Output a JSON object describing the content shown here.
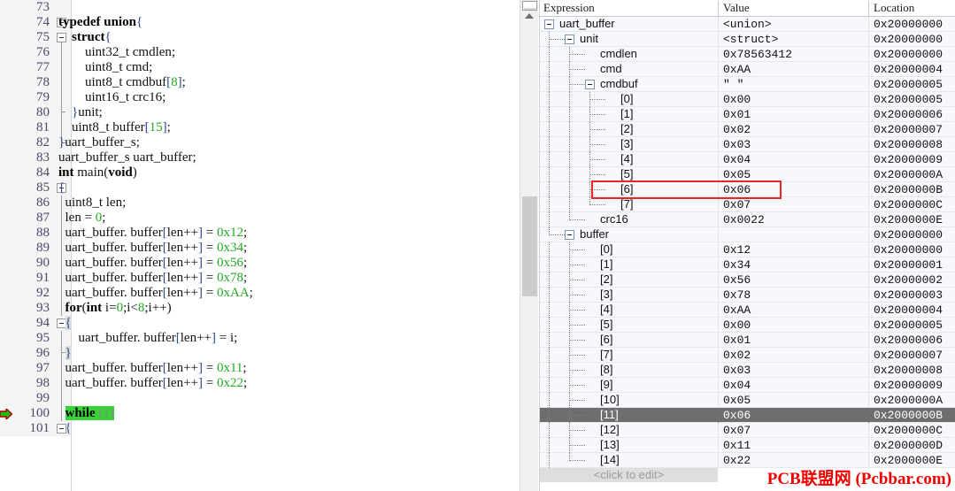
{
  "editor": {
    "first_line": 73,
    "exec_line": 100,
    "lines": [
      {
        "n": 73,
        "fold": "none",
        "tokens": []
      },
      {
        "n": 74,
        "fold": "open",
        "tokens": [
          {
            "t": "typedef union",
            "c": "kw"
          },
          {
            "t": "{",
            "c": "brk"
          }
        ]
      },
      {
        "n": 75,
        "fold": "open2",
        "tokens": [
          {
            "t": "    ",
            "c": "pln"
          },
          {
            "t": "struct",
            "c": "kw"
          },
          {
            "t": "{",
            "c": "brk"
          }
        ]
      },
      {
        "n": 76,
        "fold": "line",
        "tokens": [
          {
            "t": "        uint32_t cmdlen;",
            "c": "pln"
          }
        ]
      },
      {
        "n": 77,
        "fold": "line",
        "tokens": [
          {
            "t": "        uint8_t cmd;",
            "c": "pln"
          }
        ]
      },
      {
        "n": 78,
        "fold": "line",
        "tokens": [
          {
            "t": "        uint8_t cmdbuf",
            "c": "pln"
          },
          {
            "t": "[",
            "c": "brk"
          },
          {
            "t": "8",
            "c": "num"
          },
          {
            "t": "]",
            "c": "brk"
          },
          {
            "t": ";",
            "c": "pln"
          }
        ]
      },
      {
        "n": 79,
        "fold": "line",
        "tokens": [
          {
            "t": "        uint16_t crc16;",
            "c": "pln"
          }
        ]
      },
      {
        "n": 80,
        "fold": "endinner",
        "tokens": [
          {
            "t": "    ",
            "c": "pln"
          },
          {
            "t": "}",
            "c": "brk"
          },
          {
            "t": "unit;",
            "c": "pln"
          }
        ]
      },
      {
        "n": 81,
        "fold": "line",
        "tokens": [
          {
            "t": "    uint8_t buffer",
            "c": "pln"
          },
          {
            "t": "[",
            "c": "brk"
          },
          {
            "t": "15",
            "c": "num"
          },
          {
            "t": "]",
            "c": "brk"
          },
          {
            "t": ";",
            "c": "pln"
          }
        ]
      },
      {
        "n": 82,
        "fold": "endouter",
        "tokens": [
          {
            "t": "}",
            "c": "brk"
          },
          {
            "t": "uart_buffer_s;",
            "c": "pln"
          }
        ]
      },
      {
        "n": 83,
        "fold": "none",
        "tokens": [
          {
            "t": "uart_buffer_s uart_buffer;",
            "c": "pln"
          }
        ]
      },
      {
        "n": 84,
        "fold": "none",
        "tokens": [
          {
            "t": "int",
            "c": "kw"
          },
          {
            "t": " main(",
            "c": "pln"
          },
          {
            "t": "void",
            "c": "kw"
          },
          {
            "t": ")",
            "c": "pln"
          }
        ]
      },
      {
        "n": 85,
        "fold": "open",
        "tokens": [
          {
            "t": "{",
            "c": "brk"
          }
        ]
      },
      {
        "n": 86,
        "fold": "line",
        "tokens": [
          {
            "t": "  uint8_t len;",
            "c": "pln"
          }
        ]
      },
      {
        "n": 87,
        "fold": "line",
        "tokens": [
          {
            "t": "  len = ",
            "c": "pln"
          },
          {
            "t": "0",
            "c": "num"
          },
          {
            "t": ";",
            "c": "pln"
          }
        ]
      },
      {
        "n": 88,
        "fold": "line",
        "tokens": [
          {
            "t": "  uart_buffer. buffer",
            "c": "pln"
          },
          {
            "t": "[",
            "c": "brk"
          },
          {
            "t": "len++",
            "c": "pln"
          },
          {
            "t": "]",
            "c": "brk"
          },
          {
            "t": " = ",
            "c": "pln"
          },
          {
            "t": "0x12",
            "c": "num"
          },
          {
            "t": ";",
            "c": "pln"
          }
        ]
      },
      {
        "n": 89,
        "fold": "line",
        "tokens": [
          {
            "t": "  uart_buffer. buffer",
            "c": "pln"
          },
          {
            "t": "[",
            "c": "brk"
          },
          {
            "t": "len++",
            "c": "pln"
          },
          {
            "t": "]",
            "c": "brk"
          },
          {
            "t": " = ",
            "c": "pln"
          },
          {
            "t": "0x34",
            "c": "num"
          },
          {
            "t": ";",
            "c": "pln"
          }
        ]
      },
      {
        "n": 90,
        "fold": "line",
        "tokens": [
          {
            "t": "  uart_buffer. buffer",
            "c": "pln"
          },
          {
            "t": "[",
            "c": "brk"
          },
          {
            "t": "len++",
            "c": "pln"
          },
          {
            "t": "]",
            "c": "brk"
          },
          {
            "t": " = ",
            "c": "pln"
          },
          {
            "t": "0x56",
            "c": "num"
          },
          {
            "t": ";",
            "c": "pln"
          }
        ]
      },
      {
        "n": 91,
        "fold": "line",
        "tokens": [
          {
            "t": "  uart_buffer. buffer",
            "c": "pln"
          },
          {
            "t": "[",
            "c": "brk"
          },
          {
            "t": "len++",
            "c": "pln"
          },
          {
            "t": "]",
            "c": "brk"
          },
          {
            "t": " = ",
            "c": "pln"
          },
          {
            "t": "0x78",
            "c": "num"
          },
          {
            "t": ";",
            "c": "pln"
          }
        ]
      },
      {
        "n": 92,
        "fold": "line",
        "tokens": [
          {
            "t": "  uart_buffer. buffer",
            "c": "pln"
          },
          {
            "t": "[",
            "c": "brk"
          },
          {
            "t": "len++",
            "c": "pln"
          },
          {
            "t": "]",
            "c": "brk"
          },
          {
            "t": " = ",
            "c": "pln"
          },
          {
            "t": "0xAA",
            "c": "num"
          },
          {
            "t": ";",
            "c": "pln"
          }
        ]
      },
      {
        "n": 93,
        "fold": "line",
        "tokens": [
          {
            "t": "  ",
            "c": "pln"
          },
          {
            "t": "for",
            "c": "kw"
          },
          {
            "t": "(",
            "c": "pln"
          },
          {
            "t": "int",
            "c": "kw"
          },
          {
            "t": " i=",
            "c": "pln"
          },
          {
            "t": "0",
            "c": "num"
          },
          {
            "t": ";i<",
            "c": "pln"
          },
          {
            "t": "8",
            "c": "num"
          },
          {
            "t": ";i++)",
            "c": "pln"
          }
        ]
      },
      {
        "n": 94,
        "fold": "open",
        "tokens": [
          {
            "t": "  ",
            "c": "pln"
          },
          {
            "t": "{",
            "c": "brace-hl brk"
          }
        ]
      },
      {
        "n": 95,
        "fold": "line",
        "tokens": [
          {
            "t": "      uart_buffer. buffer",
            "c": "pln"
          },
          {
            "t": "[",
            "c": "brk"
          },
          {
            "t": "len++",
            "c": "pln"
          },
          {
            "t": "]",
            "c": "brk"
          },
          {
            "t": " = i;",
            "c": "pln"
          }
        ]
      },
      {
        "n": 96,
        "fold": "endinner",
        "tokens": [
          {
            "t": "  ",
            "c": "pln"
          },
          {
            "t": "}",
            "c": "brace-hl brk"
          }
        ]
      },
      {
        "n": 97,
        "fold": "line",
        "tokens": [
          {
            "t": "  uart_buffer. buffer",
            "c": "pln"
          },
          {
            "t": "[",
            "c": "brk"
          },
          {
            "t": "len++",
            "c": "pln"
          },
          {
            "t": "]",
            "c": "brk"
          },
          {
            "t": " = ",
            "c": "pln"
          },
          {
            "t": "0x11",
            "c": "num"
          },
          {
            "t": ";",
            "c": "pln"
          }
        ]
      },
      {
        "n": 98,
        "fold": "line",
        "tokens": [
          {
            "t": "  uart_buffer. buffer",
            "c": "pln"
          },
          {
            "t": "[",
            "c": "brk"
          },
          {
            "t": "len++",
            "c": "pln"
          },
          {
            "t": "]",
            "c": "brk"
          },
          {
            "t": " = ",
            "c": "pln"
          },
          {
            "t": "0x22",
            "c": "num"
          },
          {
            "t": ";",
            "c": "pln"
          }
        ]
      },
      {
        "n": 99,
        "fold": "line",
        "tokens": []
      },
      {
        "n": 100,
        "fold": "line",
        "exec": true,
        "tokens": [
          {
            "t": "  ",
            "c": "pln"
          },
          {
            "t": "while",
            "c": "exec-hl kw"
          },
          {
            "t": " ",
            "c": "exec-hl pln"
          },
          {
            "t": "(1)",
            "c": "exec-hl gry"
          }
        ]
      },
      {
        "n": 101,
        "fold": "open",
        "tokens": [
          {
            "t": "  ",
            "c": "pln"
          },
          {
            "t": "{",
            "c": "brk"
          }
        ]
      }
    ]
  },
  "watch": {
    "columns": [
      "Expression",
      "Value",
      "Location"
    ],
    "footer_label": "<click to edit>",
    "highlight_color": "#e8262a",
    "selected_index": 26,
    "highlighted_index": 11,
    "rows": [
      {
        "depth": 0,
        "toggle": "minus",
        "expr": "uart_buffer",
        "value": "<union>",
        "loc": "0x20000000"
      },
      {
        "depth": 1,
        "toggle": "minus",
        "expr": "unit",
        "value": "<struct>",
        "loc": "0x20000000"
      },
      {
        "depth": 2,
        "toggle": "leaf",
        "expr": "cmdlen",
        "value": "0x78563412",
        "loc": "0x20000000"
      },
      {
        "depth": 2,
        "toggle": "leaf",
        "expr": "cmd",
        "value": "0xAA",
        "loc": "0x20000004"
      },
      {
        "depth": 2,
        "toggle": "minus",
        "expr": "cmdbuf",
        "value": "\" \"",
        "loc": "0x20000005"
      },
      {
        "depth": 3,
        "toggle": "leaf",
        "expr": "[0]",
        "value": "0x00",
        "loc": "0x20000005"
      },
      {
        "depth": 3,
        "toggle": "leaf",
        "expr": "[1]",
        "value": "0x01",
        "loc": "0x20000006"
      },
      {
        "depth": 3,
        "toggle": "leaf",
        "expr": "[2]",
        "value": "0x02",
        "loc": "0x20000007"
      },
      {
        "depth": 3,
        "toggle": "leaf",
        "expr": "[3]",
        "value": "0x03",
        "loc": "0x20000008"
      },
      {
        "depth": 3,
        "toggle": "leaf",
        "expr": "[4]",
        "value": "0x04",
        "loc": "0x20000009"
      },
      {
        "depth": 3,
        "toggle": "leaf",
        "expr": "[5]",
        "value": "0x05",
        "loc": "0x2000000A"
      },
      {
        "depth": 3,
        "toggle": "leaf",
        "expr": "[6]",
        "value": "0x06",
        "loc": "0x2000000B"
      },
      {
        "depth": 3,
        "toggle": "leaflast",
        "expr": "[7]",
        "value": "0x07",
        "loc": "0x2000000C"
      },
      {
        "depth": 2,
        "toggle": "leaflast",
        "expr": "crc16",
        "value": "0x0022",
        "loc": "0x2000000E"
      },
      {
        "depth": 1,
        "toggle": "minuslast",
        "expr": "buffer",
        "value": "",
        "loc": "0x20000000"
      },
      {
        "depth": 2,
        "toggle": "leaf",
        "expr": "[0]",
        "value": "0x12",
        "loc": "0x20000000"
      },
      {
        "depth": 2,
        "toggle": "leaf",
        "expr": "[1]",
        "value": "0x34",
        "loc": "0x20000001"
      },
      {
        "depth": 2,
        "toggle": "leaf",
        "expr": "[2]",
        "value": "0x56",
        "loc": "0x20000002"
      },
      {
        "depth": 2,
        "toggle": "leaf",
        "expr": "[3]",
        "value": "0x78",
        "loc": "0x20000003"
      },
      {
        "depth": 2,
        "toggle": "leaf",
        "expr": "[4]",
        "value": "0xAA",
        "loc": "0x20000004"
      },
      {
        "depth": 2,
        "toggle": "leaf",
        "expr": "[5]",
        "value": "0x00",
        "loc": "0x20000005"
      },
      {
        "depth": 2,
        "toggle": "leaf",
        "expr": "[6]",
        "value": "0x01",
        "loc": "0x20000006"
      },
      {
        "depth": 2,
        "toggle": "leaf",
        "expr": "[7]",
        "value": "0x02",
        "loc": "0x20000007"
      },
      {
        "depth": 2,
        "toggle": "leaf",
        "expr": "[8]",
        "value": "0x03",
        "loc": "0x20000008"
      },
      {
        "depth": 2,
        "toggle": "leaf",
        "expr": "[9]",
        "value": "0x04",
        "loc": "0x20000009"
      },
      {
        "depth": 2,
        "toggle": "leaf",
        "expr": "[10]",
        "value": "0x05",
        "loc": "0x2000000A"
      },
      {
        "depth": 2,
        "toggle": "leaf",
        "expr": "[11]",
        "value": "0x06",
        "loc": "0x2000000B"
      },
      {
        "depth": 2,
        "toggle": "leaf",
        "expr": "[12]",
        "value": "0x07",
        "loc": "0x2000000C"
      },
      {
        "depth": 2,
        "toggle": "leaf",
        "expr": "[13]",
        "value": "0x11",
        "loc": "0x2000000D"
      },
      {
        "depth": 2,
        "toggle": "leaflast",
        "expr": "[14]",
        "value": "0x22",
        "loc": "0x2000000E"
      }
    ]
  },
  "watermark": {
    "text": "PCB联盟网 (Pcbbar.com)",
    "color": "#f20000"
  }
}
